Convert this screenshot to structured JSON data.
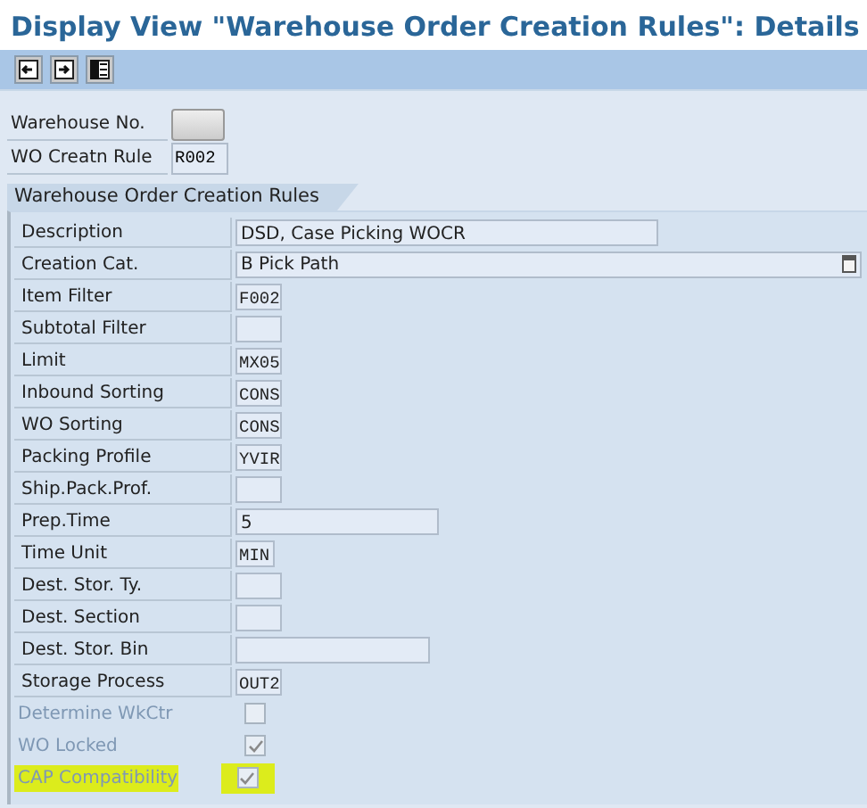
{
  "window": {
    "title": "Display View \"Warehouse Order Creation Rules\": Details"
  },
  "toolbar": {
    "buttons": [
      {
        "kind": "prev"
      },
      {
        "kind": "next"
      },
      {
        "kind": "list"
      }
    ]
  },
  "keys": [
    {
      "label": "Warehouse No.",
      "kind": "button"
    },
    {
      "label": "WO Creatn Rule",
      "value": "R002",
      "kind": "code"
    }
  ],
  "section": {
    "title": "Warehouse Order Creation Rules",
    "rows": [
      {
        "label": "Description",
        "kind": "text",
        "value": "DSD, Case Picking WOCR"
      },
      {
        "label": "Creation Cat.",
        "kind": "dropdown",
        "value": "B Pick Path"
      },
      {
        "label": "Item Filter",
        "kind": "code",
        "value": "F002"
      },
      {
        "label": "Subtotal Filter",
        "kind": "code"
      },
      {
        "label": "Limit",
        "kind": "code",
        "value": "MX05"
      },
      {
        "label": "Inbound Sorting",
        "kind": "code",
        "value": "CONS"
      },
      {
        "label": "WO Sorting",
        "kind": "code",
        "value": "CONS"
      },
      {
        "label": "Packing Profile",
        "kind": "code",
        "value": "YVIR"
      },
      {
        "label": "Ship.Pack.Prof.",
        "kind": "code"
      },
      {
        "label": "Prep.Time",
        "kind": "text",
        "value": "5"
      },
      {
        "label": "Time Unit",
        "kind": "code",
        "value": "MIN"
      },
      {
        "label": "Dest. Stor. Ty.",
        "kind": "code"
      },
      {
        "label": "Dest. Section",
        "kind": "code"
      },
      {
        "label": "Dest. Stor. Bin",
        "kind": "text"
      },
      {
        "label": "Storage Process",
        "kind": "code",
        "value": "OUT2"
      },
      {
        "label": "Determine WkCtr",
        "kind": "checkbox",
        "checked": false,
        "disabled": true,
        "highlighted": false
      },
      {
        "label": "WO Locked",
        "kind": "checkbox",
        "checked": true,
        "disabled": true,
        "highlighted": false
      },
      {
        "label": "CAP Compatibility",
        "kind": "checkbox",
        "checked": true,
        "disabled": true,
        "highlighted": true
      }
    ]
  }
}
